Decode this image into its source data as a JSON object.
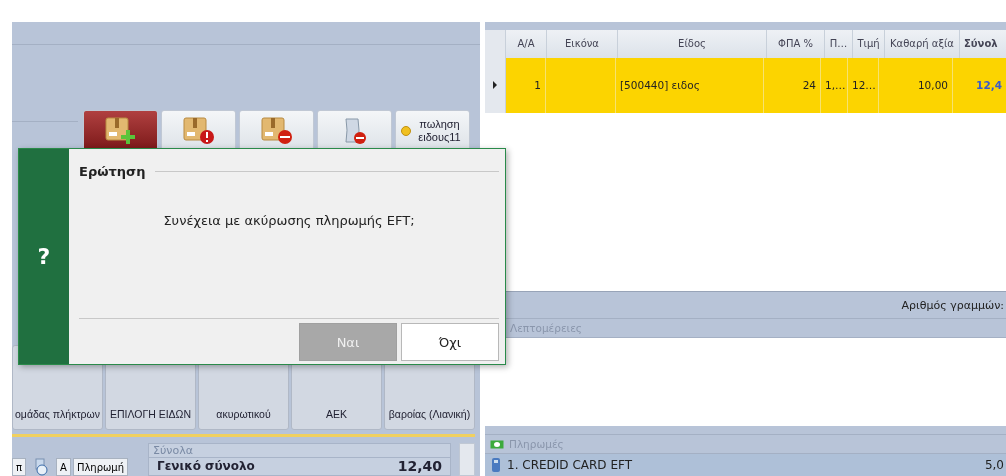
{
  "toolbar": {
    "buttons": [
      {
        "kind": "add",
        "selected": true
      },
      {
        "kind": "alert",
        "selected": false
      },
      {
        "kind": "remove",
        "selected": false
      },
      {
        "kind": "document",
        "selected": false
      },
      {
        "kind": "text",
        "label": "πωληση ειδους11",
        "selected": false
      }
    ]
  },
  "function_buttons": [
    {
      "label": "ομάδας πλήκτρων"
    },
    {
      "label": "ΕΠΙΛΟΓΗ ΕΙΔΩΝ"
    },
    {
      "label": "ακυρωτικού"
    },
    {
      "label": "ΑΕΚ"
    },
    {
      "label": "βαροίας (Λιανική)"
    }
  ],
  "quick_buttons": [
    {
      "kind": "text",
      "label": "π"
    },
    {
      "kind": "icon"
    },
    {
      "kind": "text",
      "label": "Α"
    },
    {
      "kind": "text",
      "label": "Πληρωμή"
    }
  ],
  "totals": {
    "title": "Σύνολα",
    "label": "Γενικό σύνολο",
    "value": "12,40"
  },
  "grid": {
    "columns": [
      "Α/Α",
      "Εικόνα",
      "Είδος",
      "ΦΠΑ %",
      "Π…",
      "Τιμή",
      "Καθαρή αξία",
      "Σύνολ"
    ],
    "rows": [
      {
        "selected": true,
        "aa": "1",
        "item": "[500440] ειδος",
        "vat": "24",
        "quantity": "1,…",
        "price": "12…",
        "net": "10,00",
        "total": "12,4"
      }
    ]
  },
  "row_count_label": "Αριθμός γραμμών:",
  "details": {
    "title": "Λεπτομέρειες"
  },
  "payments": {
    "title": "Πληρωμές",
    "items": [
      {
        "label": "1. CREDID CARD EFT",
        "amount": "5,0"
      }
    ]
  },
  "dialog": {
    "title": "Ερώτηση",
    "icon": "?",
    "message": "Συνέχεια με ακύρωσης πληρωμής EFT;",
    "buttons": [
      {
        "label": "Ναι",
        "selected": true
      },
      {
        "label": "Όχι",
        "selected": false
      }
    ]
  }
}
